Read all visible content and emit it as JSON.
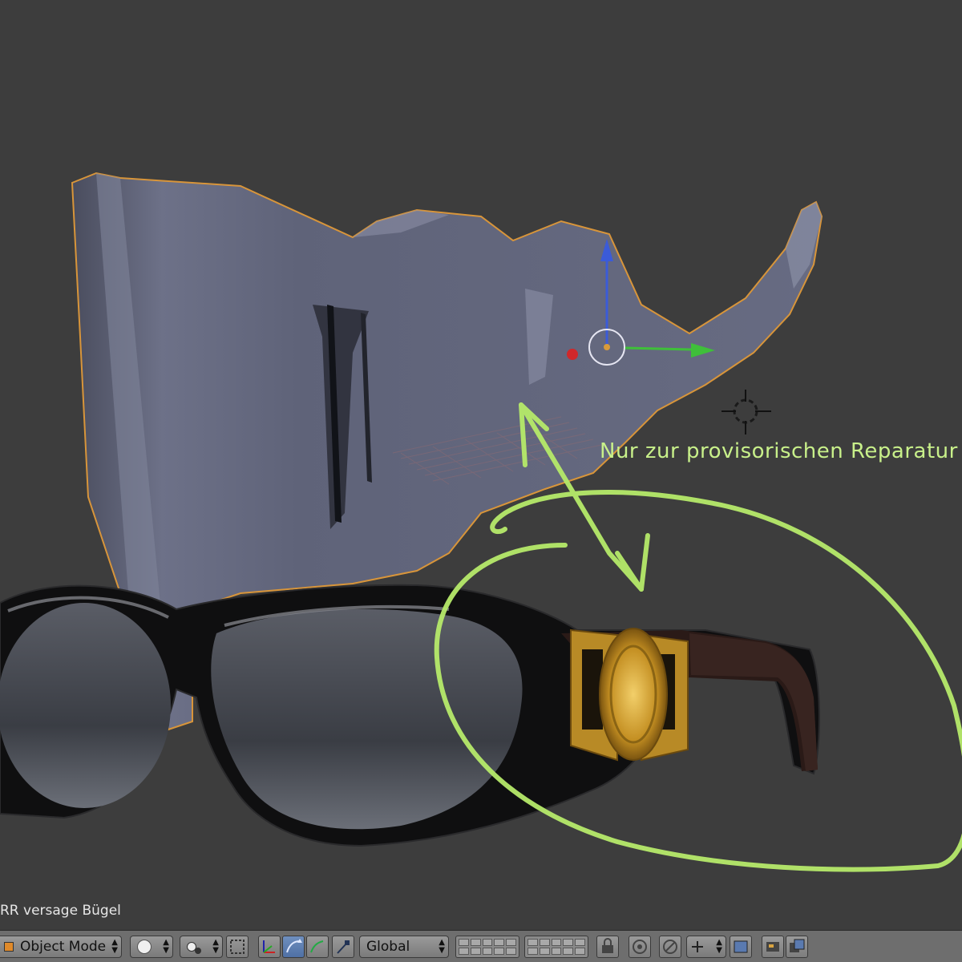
{
  "viewport": {
    "annotation_text": "Nur zur provisorischen Reparatur",
    "object_name": "RR versage Bügel",
    "annotation_color": "#b6ea6a",
    "background_color": "#3d3d3d"
  },
  "header": {
    "mode_label": "Object Mode",
    "orientation_label": "Global",
    "icons": [
      "solid-shading-icon",
      "pivot-point-icon",
      "manipulator-icon",
      "translate-icon",
      "rotate-icon",
      "scale-icon",
      "layers-grid",
      "lock-icon",
      "proportional-edit-icon",
      "snap-icon",
      "render-preview-icon",
      "copy-render-icon"
    ]
  }
}
